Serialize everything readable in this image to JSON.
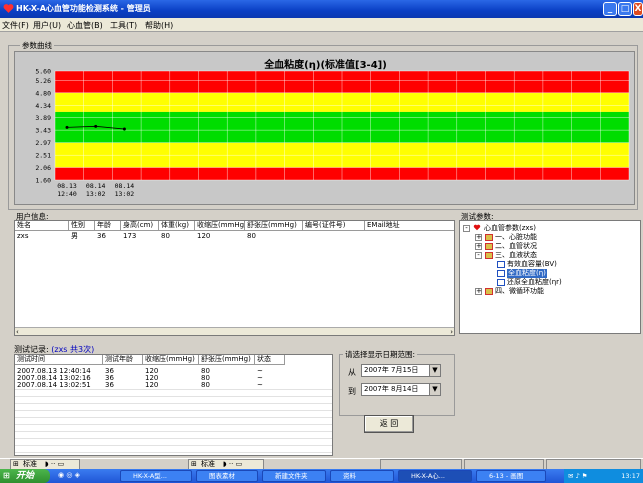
{
  "window": {
    "title": "HK-X-A心血管功能检测系统 - 管理员",
    "controls": [
      "_",
      "□",
      "X"
    ]
  },
  "menu": [
    "文件(F)",
    "用户(U)",
    "心血管(B)",
    "工具(T)",
    "帮助(H)"
  ],
  "chart_group_label": "参数曲线",
  "chart_data": {
    "type": "line",
    "title": "全血粘度(η)(标准值[3-4])",
    "y_ticks": [
      5.6,
      5.26,
      4.8,
      4.34,
      3.89,
      3.43,
      2.97,
      2.51,
      2.06,
      1.6
    ],
    "ylim": [
      1.6,
      5.6
    ],
    "x": [
      "08.13 12:40",
      "08.14 13:02",
      "08.14 13:02"
    ],
    "x_ticks": [
      {
        "date": "08.13",
        "time": "12:40"
      },
      {
        "date": "08.14",
        "time": "13:02"
      },
      {
        "date": "08.14",
        "time": "13:02"
      }
    ],
    "series": [
      {
        "values": [
          3.53,
          3.57,
          3.47
        ]
      }
    ],
    "bands": [
      {
        "from": 1.6,
        "to": 2.06,
        "color": "#ff0000"
      },
      {
        "from": 2.06,
        "to": 2.97,
        "color": "#ffff00"
      },
      {
        "from": 2.97,
        "to": 4.1,
        "color": "#00dd00"
      },
      {
        "from": 4.1,
        "to": 4.8,
        "color": "#ffff00"
      },
      {
        "from": 4.8,
        "to": 5.6,
        "color": "#ff0000"
      }
    ],
    "grid": true
  },
  "user_info": {
    "label": "用户信息:",
    "columns": [
      "姓名",
      "性别",
      "年龄",
      "身高(cm)",
      "体重(kg)",
      "收缩压(mmHg)",
      "舒张压(mmHg)",
      "编号(证件号)",
      "EMail地址"
    ],
    "rows": [
      [
        "zxs",
        "男",
        "36",
        "173",
        "80",
        "120",
        "80",
        "",
        ""
      ]
    ]
  },
  "tree": {
    "label": "测试参数:",
    "root": "心血管参数(zxs)",
    "nodes": [
      {
        "label": "一、心脏功能",
        "level": 1,
        "expand": "+"
      },
      {
        "label": "二、血管状况",
        "level": 1,
        "expand": "+"
      },
      {
        "label": "三、血液状态",
        "level": 1,
        "expand": "-"
      },
      {
        "label": "有效血容量(BV)",
        "level": 2
      },
      {
        "label": "全血粘度(η)",
        "level": 2,
        "selected": true
      },
      {
        "label": "还原全血粘度(ηr)",
        "level": 2
      },
      {
        "label": "四、微循环功能",
        "level": 1,
        "expand": "+"
      }
    ]
  },
  "test_records": {
    "label_prefix": "测试记录:",
    "label_suffix": "(zxs 共3次)",
    "columns": [
      "测试时间",
      "测试年龄",
      "收缩压(mmHg)",
      "舒张压(mmHg)",
      "状态"
    ],
    "rows": [
      [
        "2007.08.13 12:40:14",
        "36",
        "120",
        "80",
        "~"
      ],
      [
        "2007.08.14 13:02:16",
        "36",
        "120",
        "80",
        "~"
      ],
      [
        "2007.08.14 13:02:51",
        "36",
        "120",
        "80",
        "~"
      ]
    ]
  },
  "date_range": {
    "label": "请选择显示日期范围:",
    "from_label": "从",
    "from_value": "2007年 7月15日",
    "to_label": "到",
    "to_value": "2007年 8月14日",
    "back_button": "返 回"
  },
  "ime": {
    "left": "标准",
    "right": "标准"
  },
  "taskbar": {
    "start": "开始",
    "tasks": [
      "HK-X-A型...",
      "图表素材",
      "新建文件夹",
      "资料",
      "HK-X-A心...",
      "6-13 - 画图"
    ],
    "clock": "13:17"
  }
}
